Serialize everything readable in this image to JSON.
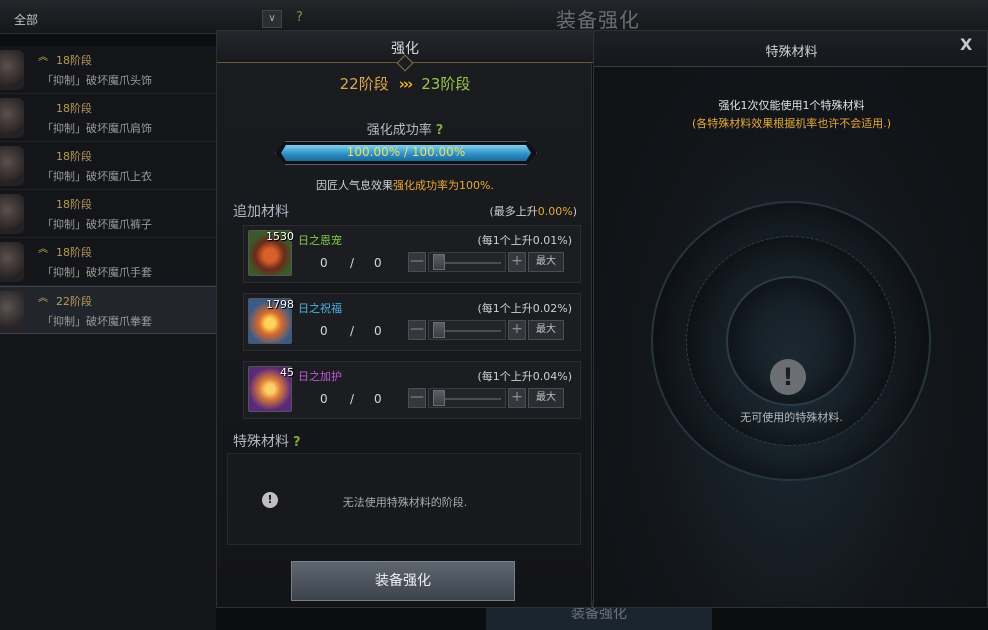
{
  "background": {
    "filter_label": "全部",
    "dropdown_glyph": "∨",
    "help_glyph": "?",
    "title": "装备强化",
    "bottom_button": "装备强化",
    "items": [
      {
        "stage": "18阶段",
        "name": "「抑制」破坏魔爪头饰",
        "has_rank_icon": true
      },
      {
        "stage": "18阶段",
        "name": "「抑制」破坏魔爪肩饰",
        "has_rank_icon": false
      },
      {
        "stage": "18阶段",
        "name": "「抑制」破坏魔爪上衣",
        "has_rank_icon": false
      },
      {
        "stage": "18阶段",
        "name": "「抑制」破坏魔爪裤子",
        "has_rank_icon": false
      },
      {
        "stage": "18阶段",
        "name": "「抑制」破坏魔爪手套",
        "has_rank_icon": true
      },
      {
        "stage": "22阶段",
        "name": "「抑制」破坏魔爪拳套",
        "has_rank_icon": true,
        "selected": true
      }
    ]
  },
  "enhance_panel": {
    "title": "强化",
    "from_stage": "22阶段",
    "arrow": "›››",
    "to_stage": "23阶段",
    "rate_label": "强化成功率",
    "help_glyph": "?",
    "rate_text": "100.00% / 100.00%",
    "rate_fraction": 1.0,
    "effect_note_prefix": "因匠人气息效果",
    "effect_note_highlight": "强化成功率为100%.",
    "add_title": "追加材料",
    "add_max_prefix": "(最多上升",
    "add_max_value": "0.00%",
    "add_max_suffix": ")",
    "materials": [
      {
        "count": "1530",
        "name": "日之恩宠",
        "per": "(每1个上升0.01%)",
        "current": "0",
        "sep": "/",
        "total": "0",
        "rarity": "green"
      },
      {
        "count": "1798",
        "name": "日之祝福",
        "per": "(每1个上升0.02%)",
        "current": "0",
        "sep": "/",
        "total": "0",
        "rarity": "blue"
      },
      {
        "count": "45",
        "name": "日之加护",
        "per": "(每1个上升0.04%)",
        "current": "0",
        "sep": "/",
        "total": "0",
        "rarity": "purple"
      }
    ],
    "minus_glyph": "—",
    "plus_glyph": "+",
    "max_label": "最大",
    "special_title": "特殊材料",
    "special_alert_glyph": "!",
    "special_msg": "无法使用特殊材料的阶段.",
    "enhance_button": "装备强化"
  },
  "special_panel": {
    "title": "特殊材料",
    "close_glyph": "X",
    "info1": "强化1次仅能使用1个特殊材料",
    "info2": "(各特殊材料效果根据机率也许不会适用.)",
    "alert_glyph": "!",
    "empty_msg": "无可使用的特殊材料."
  },
  "colors": {
    "accent_gold": "#e8a838",
    "green": "#86c84a",
    "blue": "#4ab4e8",
    "purple": "#c05ad8",
    "bar_fill": "#2a8cc2"
  }
}
